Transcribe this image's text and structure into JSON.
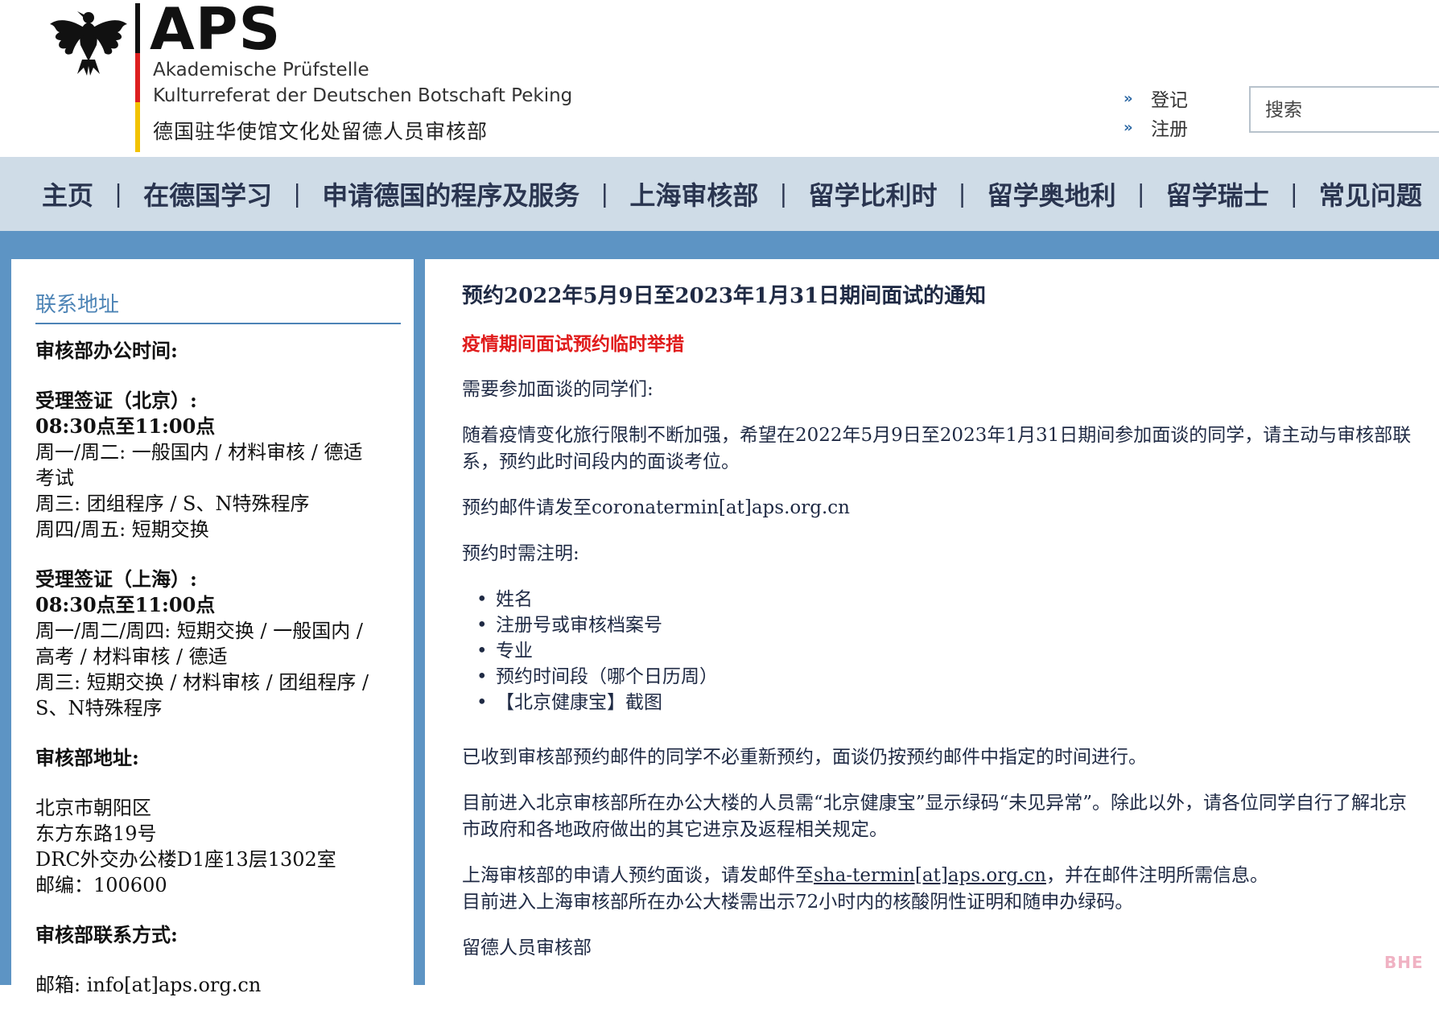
{
  "header": {
    "logo_text": "APS",
    "org_line1": "Akademische Prüfstelle",
    "org_line2": "Kulturreferat der Deutschen Botschaft Peking",
    "org_line3": "德国驻华使馆文化处留德人员审核部",
    "login_label": "登记",
    "register_label": "注册",
    "search_placeholder": "搜索"
  },
  "nav": {
    "items": [
      "主页",
      "在德国学习",
      "申请德国的程序及服务",
      "上海审核部",
      "留学比利时",
      "留学奥地利",
      "留学瑞士",
      "常见问题"
    ],
    "separator": "|"
  },
  "sidebar": {
    "title": "联系地址",
    "office_hours_heading": "审核部办公时间:",
    "beijing_heading": "受理签证（北京）:",
    "beijing_time": "08:30点至11:00点",
    "beijing_line1": "周一/周二: 一般国内 / 材料审核 / 德适考试",
    "beijing_line2": "周三: 团组程序 / S、N特殊程序",
    "beijing_line3": "周四/周五: 短期交换",
    "shanghai_heading": "受理签证（上海）:",
    "shanghai_time": "08:30点至11:00点",
    "shanghai_line1": "周一/周二/周四: 短期交换 / 一般国内 / 高考 / 材料审核 / 德适",
    "shanghai_line2": "周三: 短期交换 / 材料审核 / 团组程序 / S、N特殊程序",
    "address_heading": "审核部地址:",
    "address_line1": "北京市朝阳区",
    "address_line2": "东方东路19号",
    "address_line3": "DRC外交办公楼D1座13层1302室",
    "address_line4": "邮编：100600",
    "contact_heading": "审核部联系方式:",
    "contact_email": "邮箱: info[at]aps.org.cn"
  },
  "main": {
    "title": "预约2022年5月9日至2023年1月31日期间面试的通知",
    "subtitle": "疫情期间面试预约临时举措",
    "greeting": "需要参加面谈的同学们:",
    "para1": "随着疫情变化旅行限制不断加强，希望在2022年5月9日至2023年1月31日期间参加面谈的同学，请主动与审核部联系，预约此时间段内的面谈考位。",
    "email_prefix": "预约邮件请发至",
    "email": "coronatermin[at]aps.org.cn",
    "note_heading": "预约时需注明:",
    "note_items": [
      "姓名",
      "注册号或审核档案号",
      "专业",
      "预约时间段（哪个日历周）",
      "【北京健康宝】截图"
    ],
    "para2": "已收到审核部预约邮件的同学不必重新预约，面谈仍按预约邮件中指定的时间进行。",
    "para3": "目前进入北京审核部所在办公大楼的人员需“北京健康宝”显示绿码“未见异常”。除此以外，请各位同学自行了解北京市政府和各地政府做出的其它进京及返程相关规定。",
    "shanghai_prefix": "上海审核部的申请人预约面谈，请发邮件至",
    "shanghai_email": "sha-termin[at]aps.org.cn",
    "shanghai_suffix": "，并在邮件注明所需信息。",
    "para4": "目前进入上海审核部所在办公大楼需出示72小时内的核酸阴性证明和随申办绿码。",
    "signature": "留德人员审核部"
  },
  "watermark": "BHE",
  "colors": {
    "nav_bg": "#cfdce7",
    "page_bg": "#5d94c4",
    "accent_blue": "#4d84b6",
    "alert_red": "#e01b1b"
  }
}
